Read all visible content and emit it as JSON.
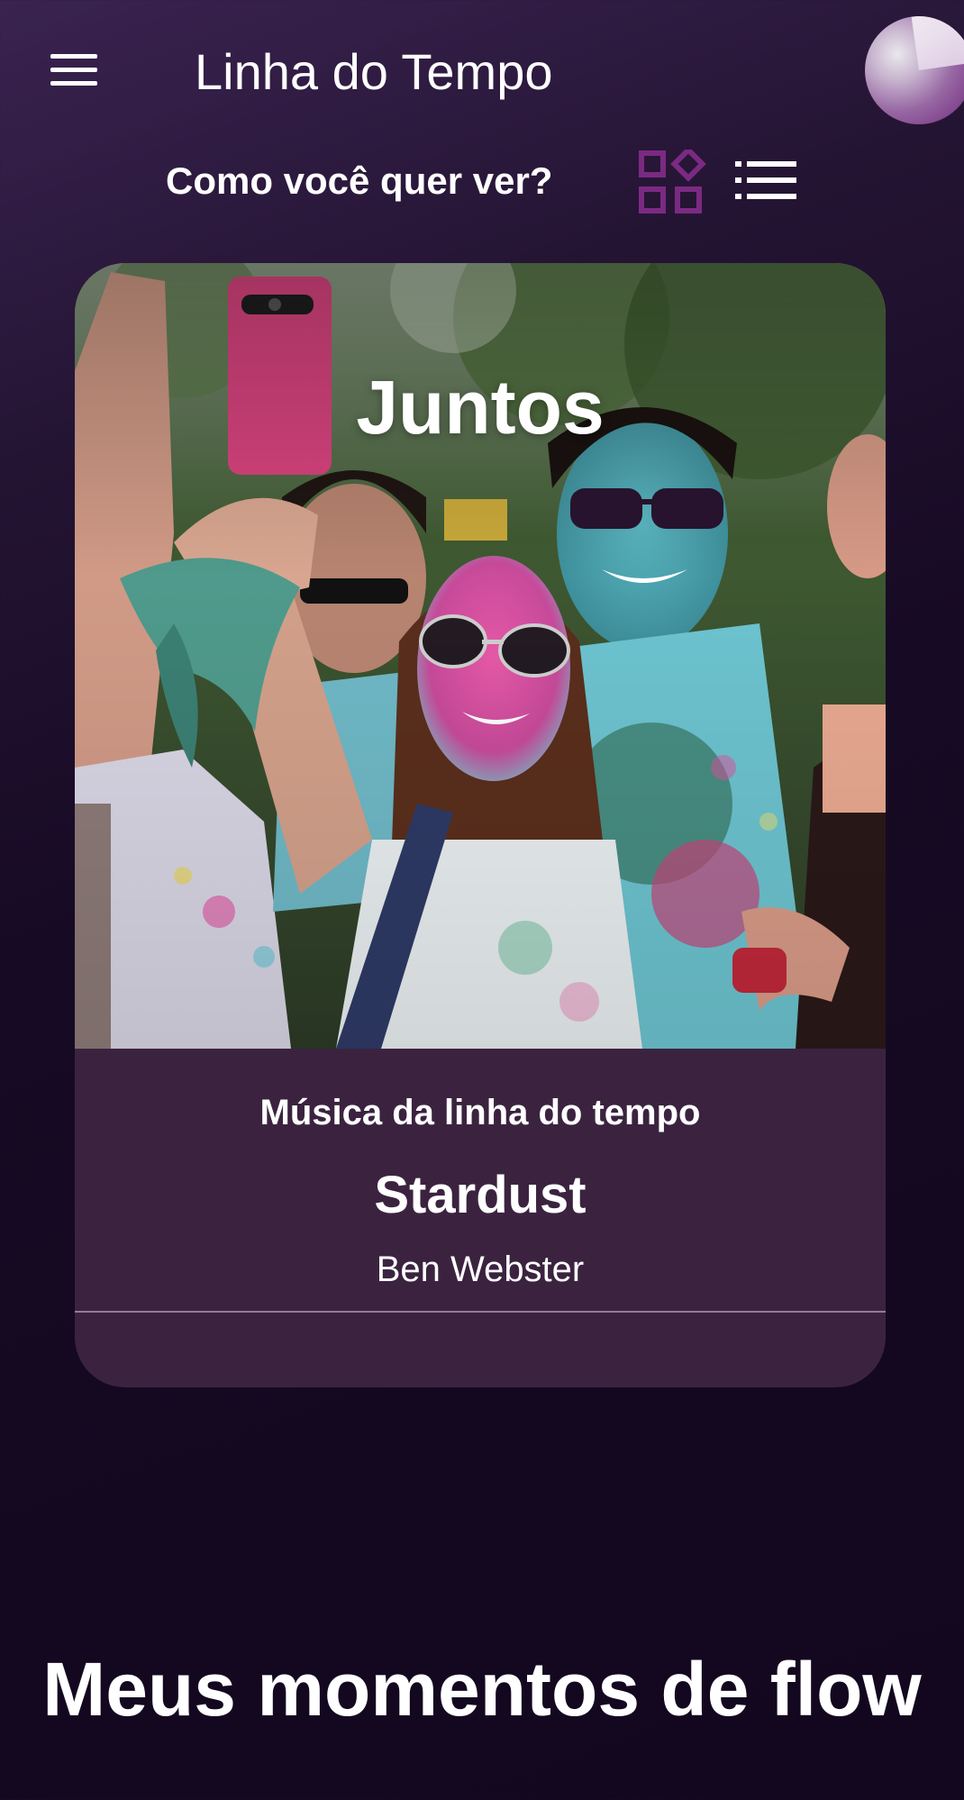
{
  "header": {
    "title": "Linha do Tempo",
    "menu_icon": "hamburger-menu-icon",
    "avatar_icon": "profile-avatar"
  },
  "view_switch": {
    "question": "Como você quer ver?",
    "options": [
      {
        "name": "grid",
        "icon": "grid-view-icon",
        "color": "#7b2a82"
      },
      {
        "name": "list",
        "icon": "list-view-icon",
        "color": "#ffffff"
      }
    ]
  },
  "timeline_card": {
    "title": "Juntos",
    "music_label": "Música da linha do tempo",
    "song": "Stardust",
    "artist": "Ben Webster",
    "playback_progress": 0
  },
  "section": {
    "heading": "Meus momentos de flow"
  },
  "colors": {
    "background_top": "#3a2350",
    "background_bottom": "#12071e",
    "card_panel": "#3b2340",
    "accent_purple": "#7b2a82"
  }
}
